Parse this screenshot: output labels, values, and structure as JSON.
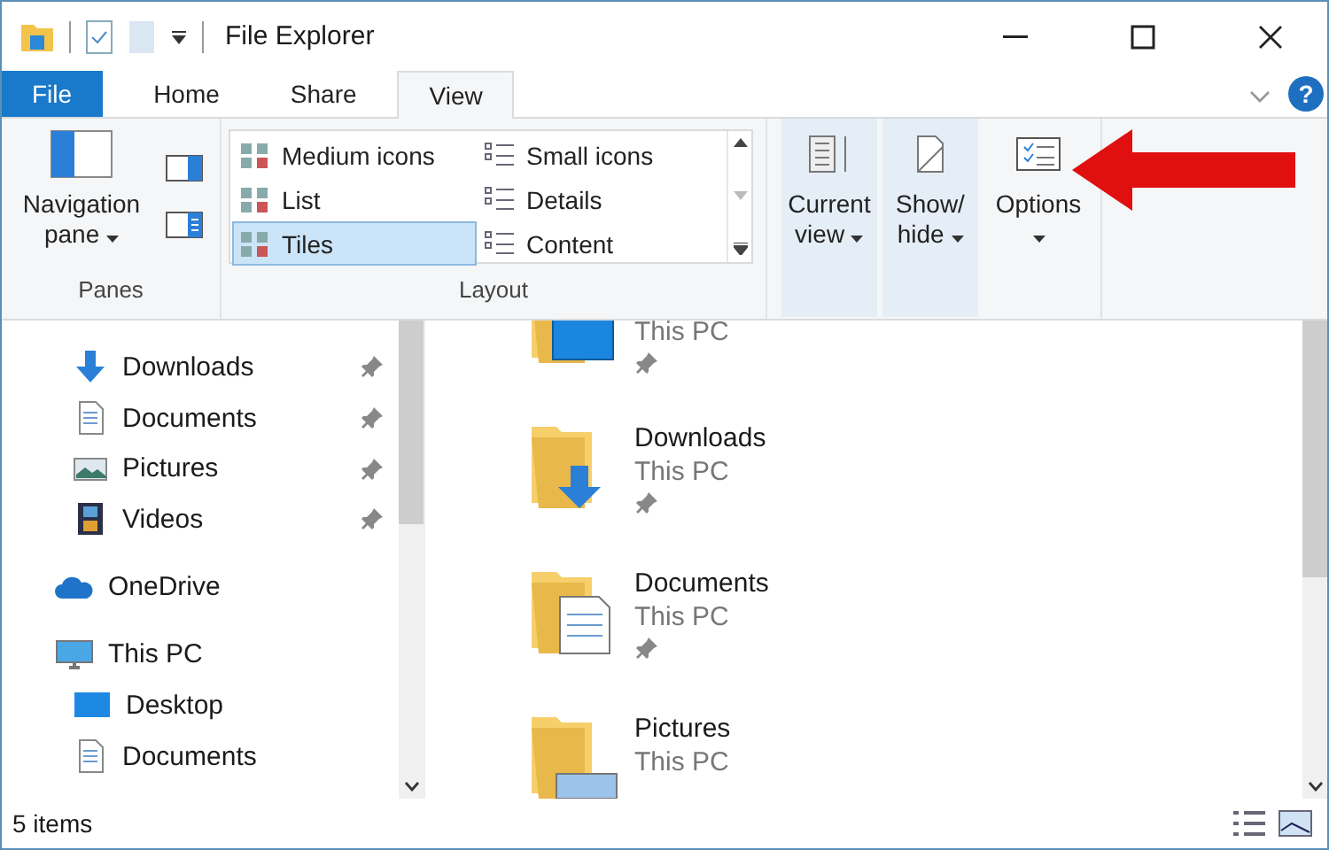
{
  "window": {
    "title": "File Explorer"
  },
  "tabs": [
    {
      "label": "File",
      "kind": "file",
      "selected": false
    },
    {
      "label": "Home",
      "kind": "tab",
      "selected": false
    },
    {
      "label": "Share",
      "kind": "tab",
      "selected": false
    },
    {
      "label": "View",
      "kind": "tab",
      "selected": true
    }
  ],
  "help_label": "?",
  "ribbon": {
    "panes": {
      "label": "Panes",
      "navigation_pane": "Navigation pane"
    },
    "layout": {
      "label": "Layout",
      "options": [
        {
          "label": "Medium icons",
          "selected": false
        },
        {
          "label": "Small icons",
          "selected": false
        },
        {
          "label": "List",
          "selected": false
        },
        {
          "label": "Details",
          "selected": false
        },
        {
          "label": "Tiles",
          "selected": true
        },
        {
          "label": "Content",
          "selected": false
        }
      ]
    },
    "buttons": [
      {
        "label": "Current view",
        "kind": "view",
        "highlighted": true
      },
      {
        "label": "Show/ hide",
        "kind": "showhide",
        "highlighted": true
      },
      {
        "label": "Options",
        "kind": "options",
        "highlighted": false
      }
    ]
  },
  "sidebar": {
    "quick_access": [
      {
        "label": "Downloads",
        "kind": "download",
        "pinned": true
      },
      {
        "label": "Documents",
        "kind": "document",
        "pinned": true
      },
      {
        "label": "Pictures",
        "kind": "picture",
        "pinned": true
      },
      {
        "label": "Videos",
        "kind": "video",
        "pinned": true
      }
    ],
    "items": [
      {
        "label": "OneDrive",
        "kind": "cloud"
      },
      {
        "label": "This PC",
        "kind": "pc",
        "children": [
          {
            "label": "Desktop",
            "kind": "desktop"
          },
          {
            "label": "Documents",
            "kind": "document"
          }
        ]
      }
    ]
  },
  "tiles": [
    {
      "kind": "desktop",
      "location": "This PC",
      "pinned": true
    },
    {
      "name": "Downloads",
      "kind": "download",
      "location": "This PC",
      "pinned": true
    },
    {
      "name": "Documents",
      "kind": "document",
      "location": "This PC",
      "pinned": true
    },
    {
      "name": "Pictures",
      "kind": "picture",
      "location": "This PC",
      "pinned": false
    }
  ],
  "status_bar": {
    "count": "5 items"
  }
}
